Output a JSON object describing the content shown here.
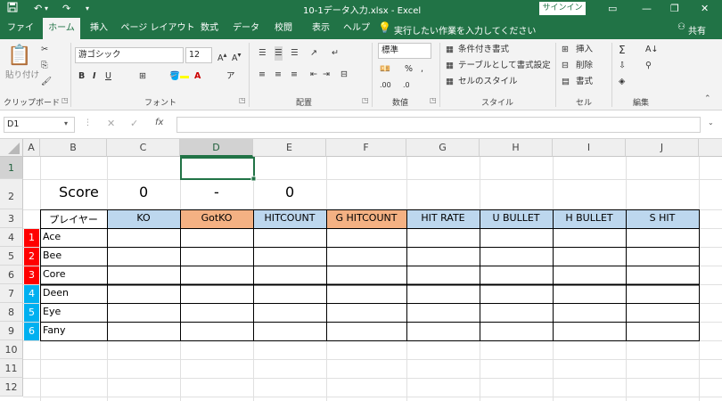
{
  "titlebar": {
    "title": "10-1データ入力.xlsx  -  Excel",
    "signin": "サインイン"
  },
  "tabs": [
    "ファイル",
    "ホーム",
    "挿入",
    "ページ レイアウト",
    "数式",
    "データ",
    "校閲",
    "表示",
    "ヘルプ"
  ],
  "tell_me": "実行したい作業を入力してください",
  "share": "共有",
  "ribbon": {
    "clipboard": {
      "paste": "貼り付け",
      "label": "クリップボード"
    },
    "font": {
      "name": "游ゴシック",
      "size": "12",
      "label": "フォント"
    },
    "alignment": {
      "label": "配置"
    },
    "number": {
      "format": "標準",
      "label": "数値"
    },
    "styles": {
      "conditional": "条件付き書式",
      "table": "テーブルとして書式設定",
      "cell_styles": "セルのスタイル",
      "label": "スタイル"
    },
    "cells": {
      "insert": "挿入",
      "delete": "削除",
      "format": "書式",
      "label": "セル"
    },
    "editing": {
      "label": "編集"
    }
  },
  "formula": {
    "name_box": "D1",
    "content": ""
  },
  "columns": [
    "A",
    "B",
    "C",
    "D",
    "E",
    "F",
    "G",
    "H",
    "I",
    "J"
  ],
  "rows": [
    "1",
    "2",
    "3",
    "4",
    "5",
    "6",
    "7",
    "8",
    "9",
    "10",
    "11",
    "12"
  ],
  "score_row": {
    "label": "Score",
    "left": "0",
    "dash": "-",
    "right": "0"
  },
  "header": {
    "player": "プレイヤー",
    "stats": [
      "KO",
      "GotKO",
      "HITCOUNT",
      "G HITCOUNT",
      "HIT RATE",
      "U BULLET",
      "H BULLET",
      "S HIT"
    ]
  },
  "players": [
    {
      "num": "1",
      "name": "Ace"
    },
    {
      "num": "2",
      "name": "Bee"
    },
    {
      "num": "3",
      "name": "Core"
    },
    {
      "num": "4",
      "name": "Deen"
    },
    {
      "num": "5",
      "name": "Eye"
    },
    {
      "num": "6",
      "name": "Fany"
    }
  ],
  "colors": {
    "excel_green": "#217346",
    "header_blue": "#bdd7ee",
    "header_orange": "#f4b183",
    "team_red": "#ff0000",
    "team_blue": "#00b0f0"
  }
}
